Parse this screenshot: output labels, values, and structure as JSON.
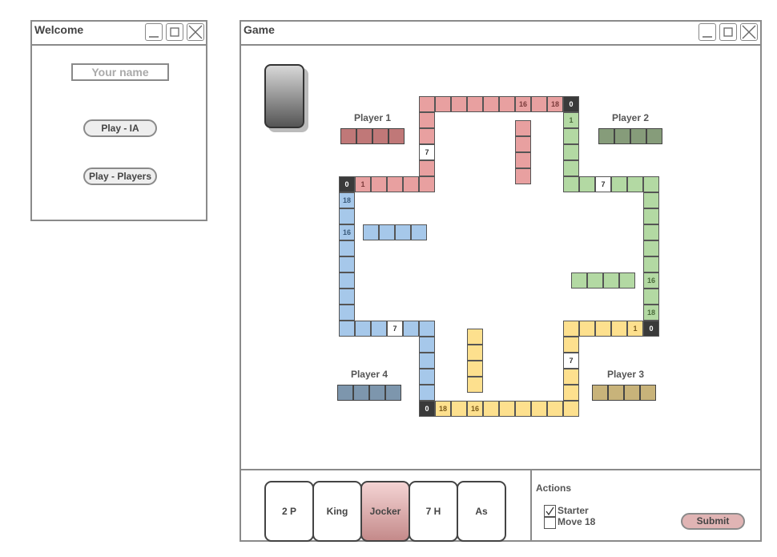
{
  "welcome": {
    "title": "Welcome",
    "name_placeholder": "Your name",
    "play_ia_label": "Play - IA",
    "play_players_label": "Play - Players"
  },
  "game": {
    "title": "Game",
    "players": [
      {
        "label": "Player 1",
        "color": "#e8a0a0",
        "home_color": "#c07878"
      },
      {
        "label": "Player 2",
        "color": "#b3d9a3",
        "home_color": "#869c7a"
      },
      {
        "label": "Player 3",
        "color": "#fde08e",
        "home_color": "#c8b37a"
      },
      {
        "label": "Player 4",
        "color": "#a6c8ea",
        "home_color": "#7d96ad"
      }
    ],
    "track_numbers": {
      "start": "0",
      "one": "1",
      "seven": "7",
      "sixteen": "16",
      "eighteen": "18"
    }
  },
  "hand": {
    "cards": [
      {
        "label": "2 P",
        "selected": false
      },
      {
        "label": "King",
        "selected": false
      },
      {
        "label": "Jocker",
        "selected": true
      },
      {
        "label": "7 H",
        "selected": false
      },
      {
        "label": "As",
        "selected": false
      }
    ]
  },
  "actions": {
    "title": "Actions",
    "starter_label": "Starter",
    "starter_checked": true,
    "move18_label": "Move 18",
    "move18_checked": false,
    "submit_label": "Submit"
  }
}
